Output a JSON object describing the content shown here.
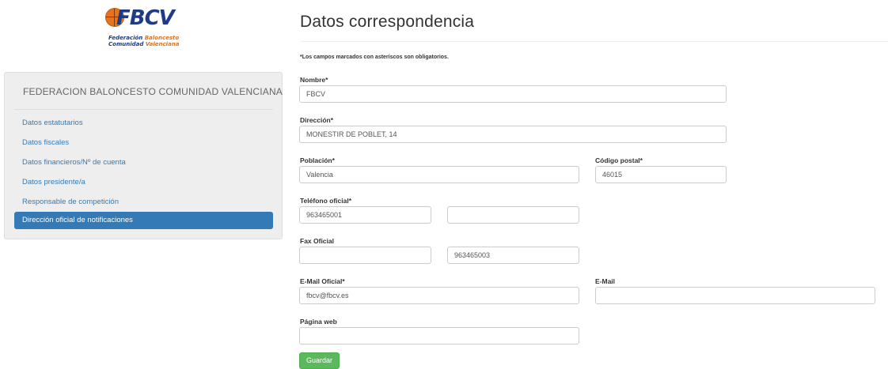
{
  "logo": {
    "abbr": "FBCV",
    "line1_a": "Federación ",
    "line1_b": "Baloncesto",
    "line2_a": "Comunidad ",
    "line2_b": "Valenciana"
  },
  "sidebar": {
    "title": "FEDERACION BALONCESTO COMUNIDAD VALENCIANA",
    "items": [
      {
        "label": "Datos estatutarios"
      },
      {
        "label": "Datos fiscales"
      },
      {
        "label": "Datos financieros/Nº de cuenta"
      },
      {
        "label": "Datos presidente/a"
      },
      {
        "label": "Responsable de competición"
      },
      {
        "label": "Dirección oficial de notificaciones"
      }
    ]
  },
  "main": {
    "title": "Datos correspondencia",
    "note": "*Los campos marcados con asteríscos son obligatorios.",
    "fields": {
      "nombre": {
        "label": "Nombre*",
        "value": "FBCV"
      },
      "direccion": {
        "label": "Dirección*",
        "value": "MONESTIR DE POBLET, 14"
      },
      "poblacion": {
        "label": "Población*",
        "value": "Valencia"
      },
      "codigo_postal": {
        "label": "Código postal*",
        "value": "46015"
      },
      "telefono": {
        "label": "Teléfono oficial*",
        "value1": "963465001",
        "value2": ""
      },
      "fax": {
        "label": "Fax Oficial",
        "value1": "",
        "value2": "963465003"
      },
      "email_oficial": {
        "label": "E-Mail Oficial*",
        "value": "fbcv@fbcv.es"
      },
      "email": {
        "label": "E-Mail",
        "value": ""
      },
      "web": {
        "label": "Página web",
        "value": ""
      }
    },
    "save_label": "Guardar"
  },
  "colors": {
    "link": "#337ab7",
    "active_bg": "#337ab7",
    "button": "#5cb85c",
    "logo_blue": "#1f3b86",
    "logo_orange": "#e8731a"
  }
}
